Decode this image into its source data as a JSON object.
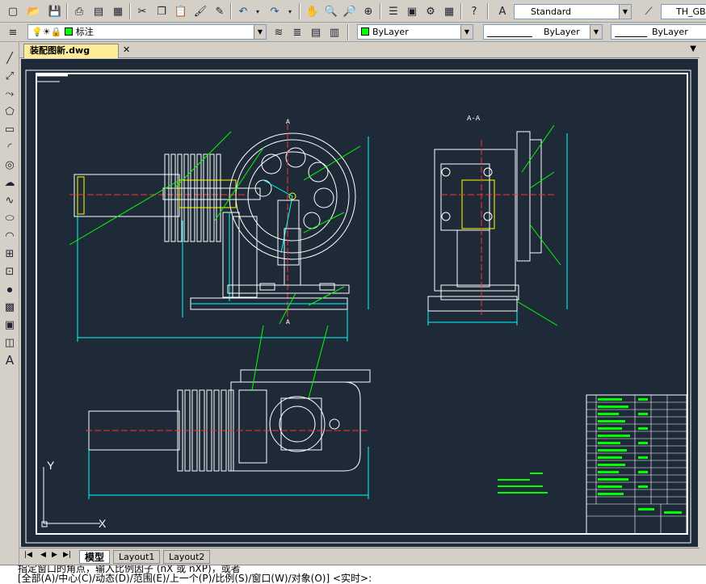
{
  "toolbar_top": {
    "text_style": "Standard",
    "dim_style": "TH_GBD"
  },
  "toolbar_layers": {
    "current_layer": "标注",
    "color": "ByLayer",
    "linetype": "ByLayer",
    "lineweight": "ByLayer",
    "layer_color_hex": "#00ff00"
  },
  "document": {
    "tab_label": "装配图新.dwg"
  },
  "drawing": {
    "section_label": "A-A",
    "cut_label_top": "A",
    "cut_label_bottom": "A",
    "ucs_x": "X",
    "ucs_y": "Y"
  },
  "layout_tabs": [
    "模型",
    "Layout1",
    "Layout2"
  ],
  "command_line": {
    "line1": "指定窗口的角点，输入比例因子 (nX 或 nXP)，或者",
    "line2": "[全部(A)/中心(C)/动态(D)/范围(E)/上一个(P)/比例(S)/窗口(W)/对象(O)] <实时>:"
  },
  "colors": {
    "canvas_bg": "#1e2a37",
    "cad_white": "#ffffff",
    "cad_green": "#00ff00",
    "cad_cyan": "#00ffff",
    "cad_yellow": "#ffff00",
    "cad_red": "#ff3030"
  }
}
